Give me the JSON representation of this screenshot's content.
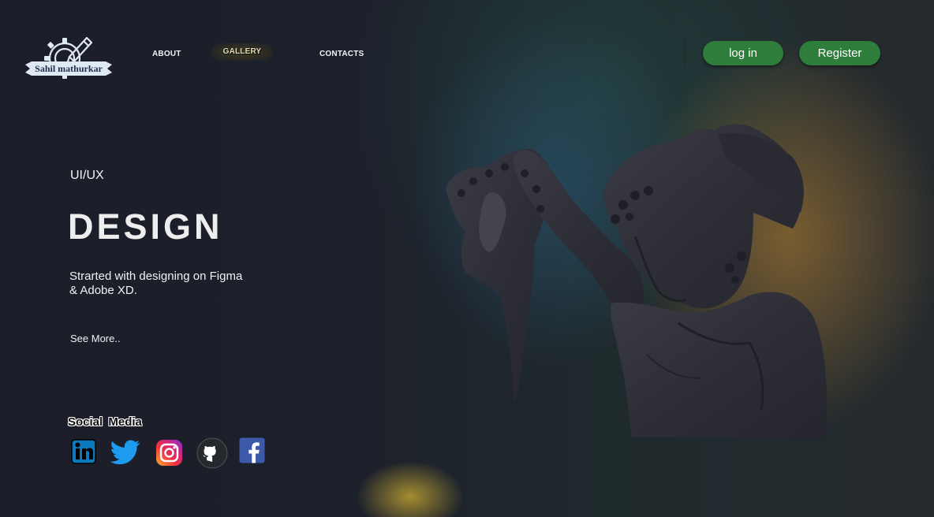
{
  "logo": {
    "text": "Sahil mathurkar"
  },
  "nav": {
    "about": "ABOUT",
    "gallery": "GALLERY",
    "contacts": "CONTACTS"
  },
  "auth": {
    "login": "log in",
    "register": "Register"
  },
  "hero": {
    "subtitle": "UI/UX",
    "title": "DESIGN",
    "description": "Strarted with designing on Figma & Adobe XD.",
    "see_more": "See More.."
  },
  "social": {
    "title": "Social  Media",
    "icons": [
      "linkedin-icon",
      "twitter-icon",
      "instagram-icon",
      "github-icon",
      "facebook-icon"
    ]
  },
  "colors": {
    "button_green": "#2f7d3b",
    "background": "#1c1e2a"
  }
}
